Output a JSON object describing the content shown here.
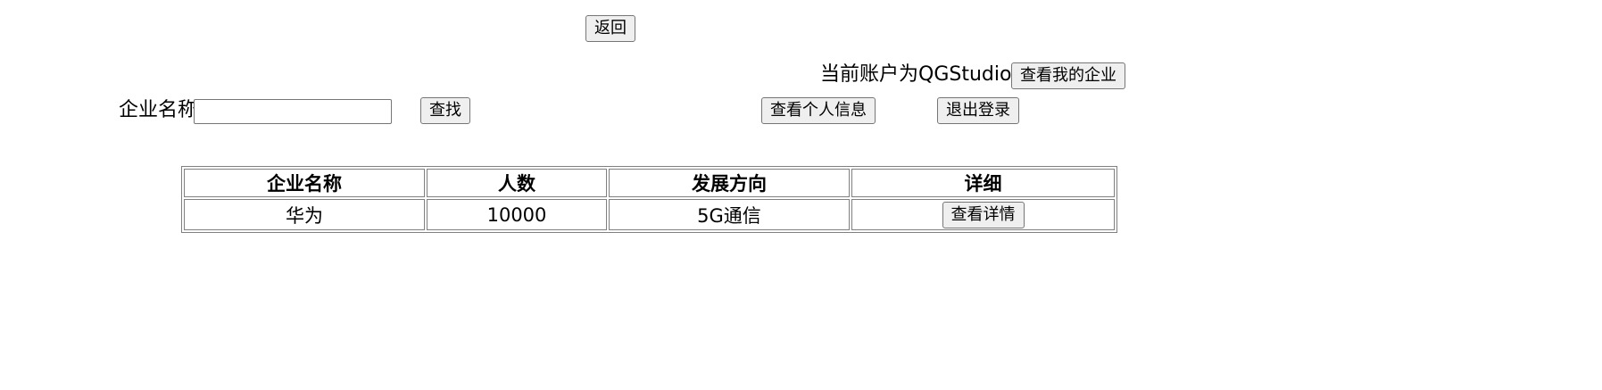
{
  "header": {
    "back_label": "返回"
  },
  "account": {
    "current_account_text": "当前账户为QGStudio",
    "my_company_label": "查看我的企业",
    "view_personal_info_label": "查看个人信息",
    "logout_label": "退出登录"
  },
  "search": {
    "field_label": "企业名称",
    "input_value": "",
    "button_label": "查找"
  },
  "table": {
    "headers": [
      "企业名称",
      "人数",
      "发展方向",
      "详细"
    ],
    "rows": [
      {
        "name": "华为",
        "headcount": "10000",
        "direction": "5G通信",
        "detail_label": "查看详情"
      }
    ]
  }
}
